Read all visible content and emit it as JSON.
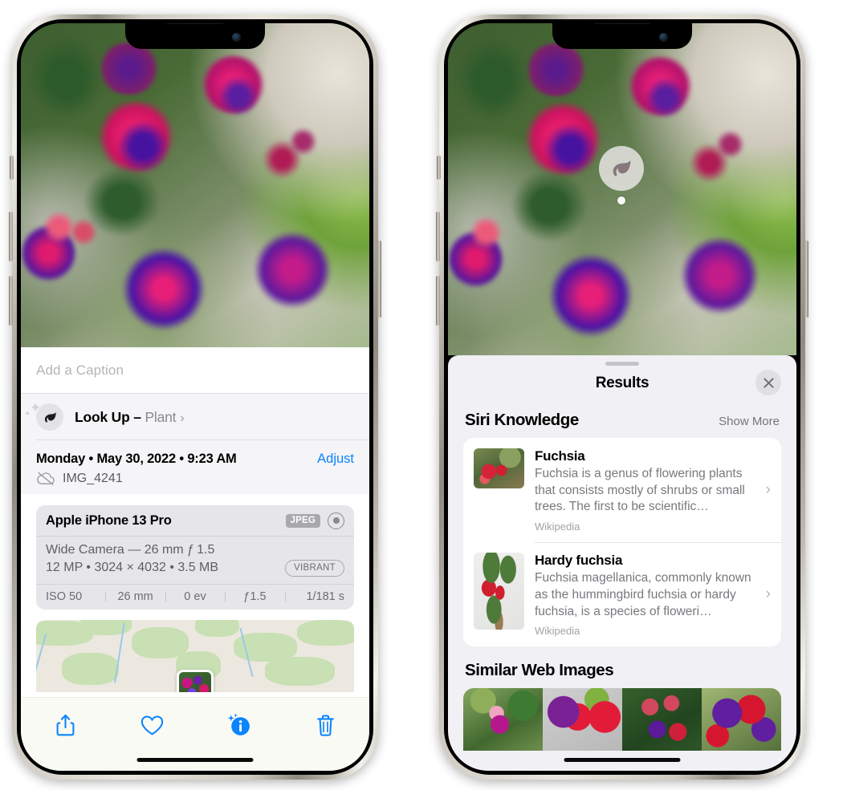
{
  "left_phone": {
    "name": "iphone-photos-info",
    "photo": {
      "alt": "fuchsia-flowers-photo"
    },
    "caption_field": {
      "placeholder": "Add a Caption",
      "value": ""
    },
    "look_up": {
      "label": "Look Up",
      "dash": " – ",
      "subject": "Plant",
      "chevron": "›",
      "icon": "leaf-icon"
    },
    "meta": {
      "date": "Monday • May 30, 2022 • 9:23 AM",
      "adjust_label": "Adjust",
      "filename": "IMG_4241",
      "cloud_icon": "icloud-slash-icon"
    },
    "exif": {
      "device": "Apple iPhone 13 Pro",
      "format_tag": "JPEG",
      "lens_icon": "lens-icon",
      "lens_line": "Wide Camera — 26 mm ƒ 1.5",
      "size_line": "12 MP • 3024 × 4032 • 3.5 MB",
      "style_tag": "VIBRANT",
      "stats": [
        "ISO 50",
        "26 mm",
        "0 ev",
        "ƒ1.5",
        "1/181 s"
      ]
    },
    "map": {
      "name": "location-map",
      "pin": "photo-pin"
    },
    "toolbar": [
      {
        "name": "share-button",
        "icon": "share-icon"
      },
      {
        "name": "favorite-button",
        "icon": "heart-icon"
      },
      {
        "name": "info-button",
        "icon": "info-sparkle-icon"
      },
      {
        "name": "delete-button",
        "icon": "trash-icon"
      }
    ]
  },
  "right_phone": {
    "name": "iphone-visual-lookup-results",
    "badge": {
      "name": "visual-lookup-badge",
      "icon": "leaf-icon"
    },
    "sheet": {
      "grabber": "sheet-grabber",
      "title": "Results",
      "close_icon": "close-icon"
    },
    "siri_knowledge": {
      "title": "Siri Knowledge",
      "show_more": "Show More",
      "items": [
        {
          "name": "Fuchsia",
          "desc": "Fuchsia is a genus of flowering plants that consists mostly of shrubs or small trees. The first to be scientific…",
          "source": "Wikipedia",
          "chevron": "›",
          "thumb": "fuchsia-red-flowers-thumb"
        },
        {
          "name": "Hardy fuchsia",
          "desc": "Fuchsia magellanica, commonly known as the hummingbird fuchsia or hardy fuchsia, is a species of floweri…",
          "source": "Wikipedia",
          "chevron": "›",
          "thumb": "hardy-fuchsia-branch-thumb"
        }
      ]
    },
    "similar_web_images": {
      "title": "Similar Web Images",
      "thumbs": [
        "fuchsia-pink-white-thumb",
        "fuchsia-red-closeup-thumb",
        "fuchsia-bush-thumb",
        "fuchsia-purple-red-thumb"
      ]
    }
  },
  "colors": {
    "accent_blue": "#0a84ff",
    "sheet_bg": "#f1f0f4",
    "exif_bg": "#e6e5e9",
    "secondary_text": "#79787e"
  }
}
